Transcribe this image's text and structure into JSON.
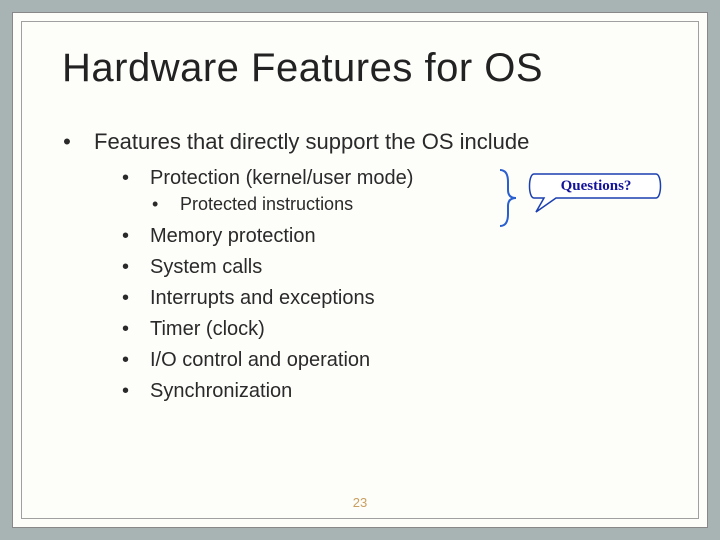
{
  "title": "Hardware Features for OS",
  "intro": "Features that directly support the OS include",
  "protection": "Protection (kernel/user mode)",
  "protected_instr": "Protected instructions",
  "items": {
    "i0": "Memory protection",
    "i1": "System calls",
    "i2": "Interrupts and exceptions",
    "i3": "Timer (clock)",
    "i4": "I/O control and operation",
    "i5": "Synchronization"
  },
  "annotation": "Questions?",
  "page_number": "23"
}
